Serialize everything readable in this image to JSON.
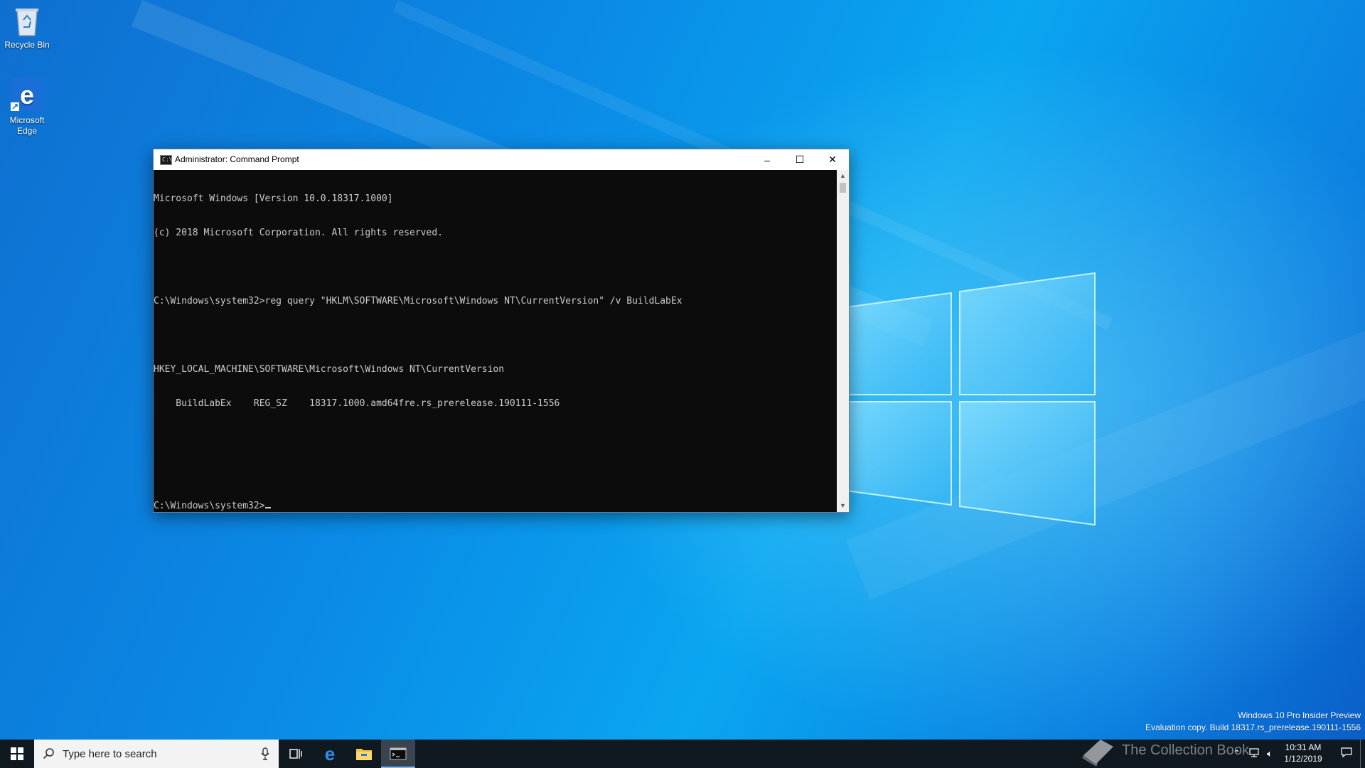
{
  "desktop": {
    "icons": [
      {
        "label": "Recycle Bin",
        "icon": "recycle-bin-icon"
      },
      {
        "label": "Microsoft\nEdge",
        "icon": "edge-icon"
      }
    ],
    "watermark": {
      "line1": "Windows 10 Pro Insider Preview",
      "line2": "Evaluation copy. Build 18317.rs_prerelease.190111-1556"
    }
  },
  "cmd_window": {
    "title": "Administrator: Command Prompt",
    "controls": {
      "minimize": "–",
      "maximize": "☐",
      "close": "✕"
    },
    "lines": [
      "Microsoft Windows [Version 10.0.18317.1000]",
      "(c) 2018 Microsoft Corporation. All rights reserved.",
      "",
      "C:\\Windows\\system32>reg query \"HKLM\\SOFTWARE\\Microsoft\\Windows NT\\CurrentVersion\" /v BuildLabEx",
      "",
      "HKEY_LOCAL_MACHINE\\SOFTWARE\\Microsoft\\Windows NT\\CurrentVersion",
      "    BuildLabEx    REG_SZ    18317.1000.amd64fre.rs_prerelease.190111-1556",
      "",
      ""
    ],
    "prompt": "C:\\Windows\\system32>",
    "colors": {
      "background": "#0c0c0c",
      "text": "#cccccc"
    }
  },
  "taskbar": {
    "search_placeholder": "Type here to search",
    "pinned": [
      "task-view-icon",
      "edge-icon",
      "file-explorer-icon",
      "command-prompt-icon"
    ],
    "active": "command-prompt-icon",
    "clock": {
      "time": "10:31 AM",
      "date": "1/12/2019"
    },
    "overlay_text": "The Collection Book",
    "colors": {
      "taskbar": "#101820",
      "accent": "#7fb8ee"
    }
  }
}
